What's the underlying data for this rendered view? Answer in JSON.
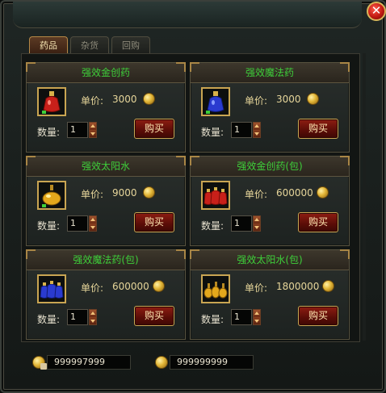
{
  "tabs": [
    {
      "label": "药品",
      "active": true
    },
    {
      "label": "杂货",
      "active": false
    },
    {
      "label": "回购",
      "active": false
    }
  ],
  "close_icon": "close-icon",
  "items": [
    {
      "name": "强效金创药",
      "price_label": "单价:",
      "price": "3000",
      "qty_label": "数量:",
      "qty": "1",
      "buy_label": "购买",
      "icon": "red-potion-icon",
      "potion_color": "#c8201a"
    },
    {
      "name": "强效魔法药",
      "price_label": "单价:",
      "price": "3000",
      "qty_label": "数量:",
      "qty": "1",
      "buy_label": "购买",
      "icon": "blue-potion-icon",
      "potion_color": "#2a3bd0"
    },
    {
      "name": "强效太阳水",
      "price_label": "单价:",
      "price": "9000",
      "qty_label": "数量:",
      "qty": "1",
      "buy_label": "购买",
      "icon": "gold-potion-icon",
      "potion_color": "#e3a81c"
    },
    {
      "name": "强效金创药(包)",
      "price_label": "单价:",
      "price": "600000",
      "qty_label": "数量:",
      "qty": "1",
      "buy_label": "购买",
      "icon": "red-potion-pack-icon",
      "potion_color": "#c8201a"
    },
    {
      "name": "强效魔法药(包)",
      "price_label": "单价:",
      "price": "600000",
      "qty_label": "数量:",
      "qty": "1",
      "buy_label": "购买",
      "icon": "blue-potion-pack-icon",
      "potion_color": "#2a3bd0"
    },
    {
      "name": "强效太阳水(包)",
      "price_label": "单价:",
      "price": "1800000",
      "qty_label": "数量:",
      "qty": "1",
      "buy_label": "购买",
      "icon": "gold-potion-pack-icon",
      "potion_color": "#e3a81c"
    }
  ],
  "currency": {
    "bound_gold": "999997999",
    "gold": "999999999"
  },
  "colors": {
    "item_name": "#3ecf3a",
    "price_text": "#e6d59a",
    "buy_button": "#8e1d12",
    "frame_gold": "#c9a552"
  }
}
